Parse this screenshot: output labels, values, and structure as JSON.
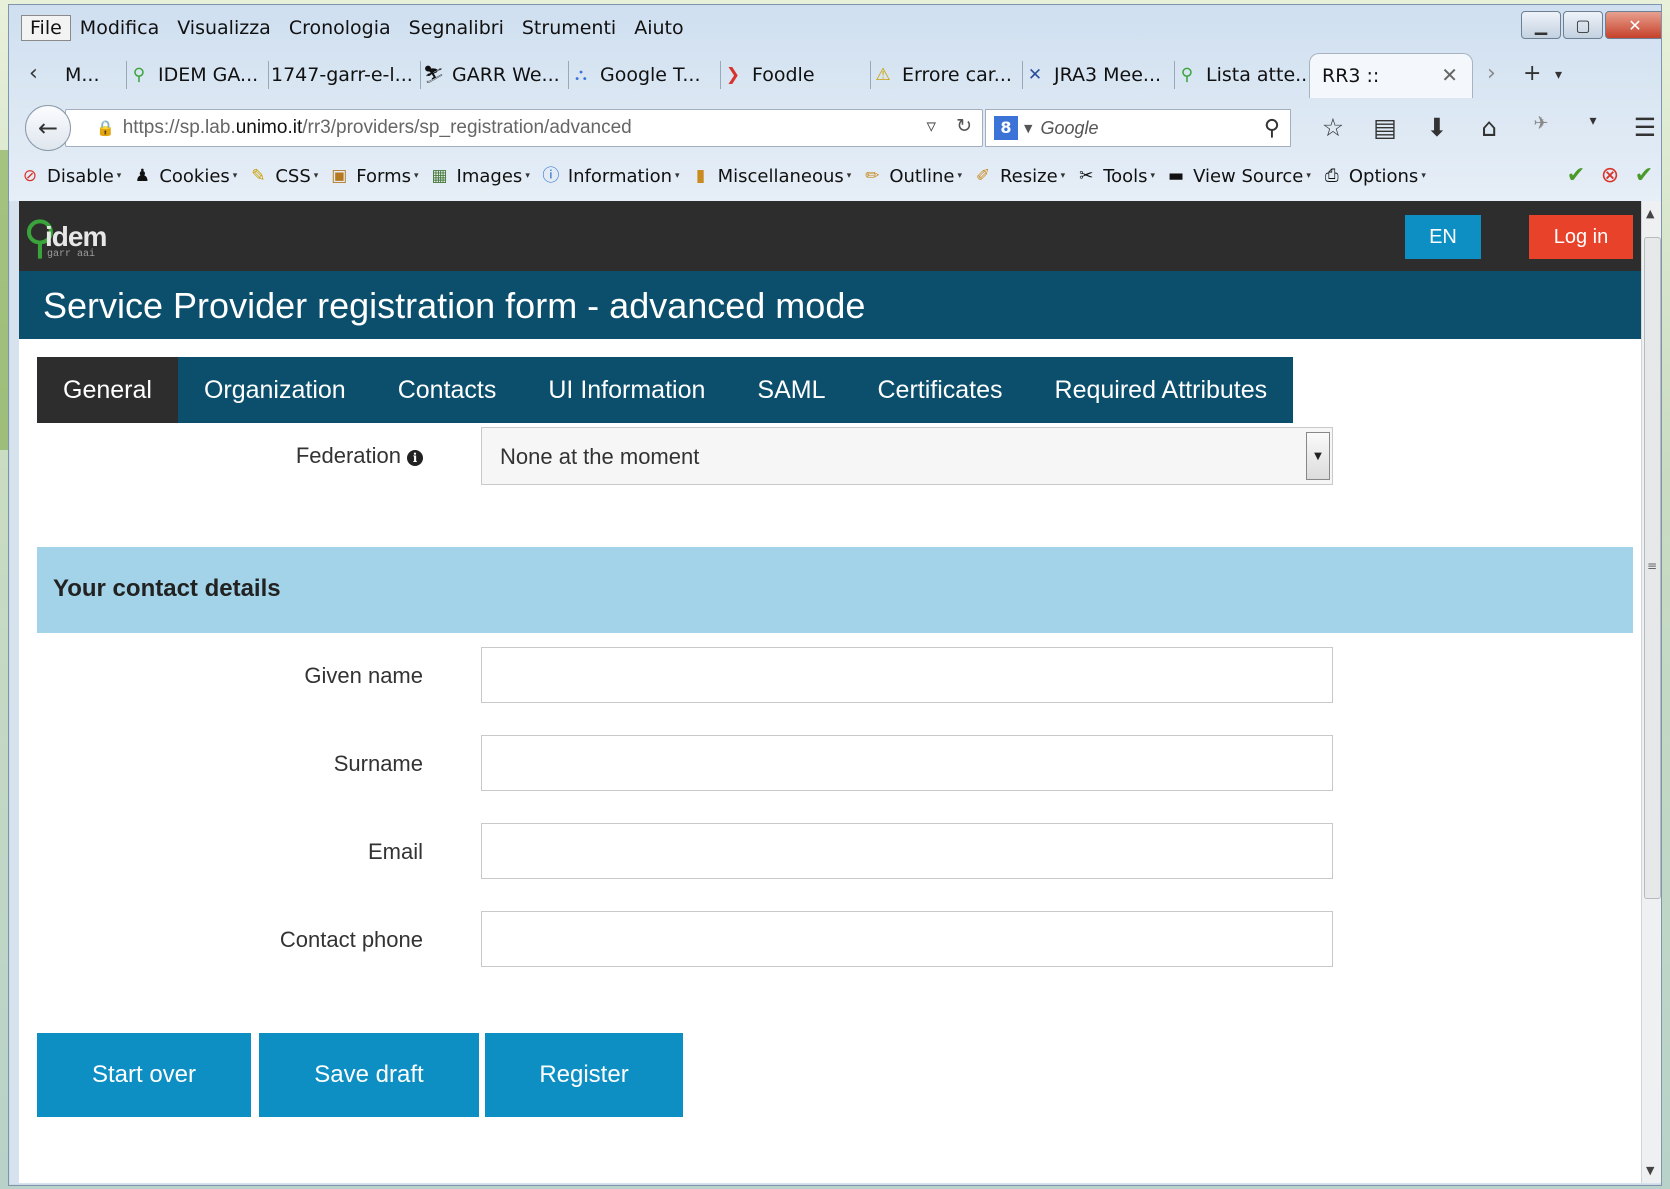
{
  "menubar": [
    "File",
    "Modifica",
    "Visualizza",
    "Cronologia",
    "Segnalibri",
    "Strumenti",
    "Aiuto"
  ],
  "tabs": [
    {
      "label": "M...",
      "icon": "page-icon"
    },
    {
      "label": "IDEM GA...",
      "icon": "idem-key-icon"
    },
    {
      "label": "1747-garr-e-l...",
      "icon": "none"
    },
    {
      "label": "GARR We...",
      "icon": "garr-icon"
    },
    {
      "label": "Google T...",
      "icon": "translate-icon"
    },
    {
      "label": "Foodle",
      "icon": "foodle-icon"
    },
    {
      "label": "Errore car...",
      "icon": "warning-icon"
    },
    {
      "label": "JRA3 Mee...",
      "icon": "jra3-icon"
    },
    {
      "label": "Lista atte...",
      "icon": "idem-key-icon"
    },
    {
      "label": "RR3 ::",
      "icon": "none",
      "active": true
    }
  ],
  "address": {
    "prefix": "https://sp.lab.",
    "domain": "unimo.it",
    "path": "/rr3/providers/sp_registration/advanced"
  },
  "search": {
    "placeholder": "Google"
  },
  "devbar": [
    "Disable",
    "Cookies",
    "CSS",
    "Forms",
    "Images",
    "Information",
    "Miscellaneous",
    "Outline",
    "Resize",
    "Tools",
    "View Source",
    "Options"
  ],
  "site": {
    "logo_word": "idem",
    "logo_sub": "garr aai",
    "lang_button": "EN",
    "login_button": "Log in",
    "page_title": "Service Provider registration form - advanced mode"
  },
  "form_tabs": [
    "General",
    "Organization",
    "Contacts",
    "UI Information",
    "SAML",
    "Certificates",
    "Required Attributes"
  ],
  "federation": {
    "label": "Federation",
    "selected": "None at the moment"
  },
  "section_title": "Your contact details",
  "fields": [
    {
      "label": "Given name",
      "value": ""
    },
    {
      "label": "Surname",
      "value": ""
    },
    {
      "label": "Email",
      "value": ""
    },
    {
      "label": "Contact phone",
      "value": ""
    }
  ],
  "actions": {
    "start_over": "Start over",
    "save_draft": "Save draft",
    "register": "Register"
  },
  "colors": {
    "header_dark": "#2d2d2d",
    "title_band": "#0b4f6c",
    "primary_button": "#0d8fc4",
    "login_button": "#e8432a",
    "section_band": "#a3d3e8"
  }
}
